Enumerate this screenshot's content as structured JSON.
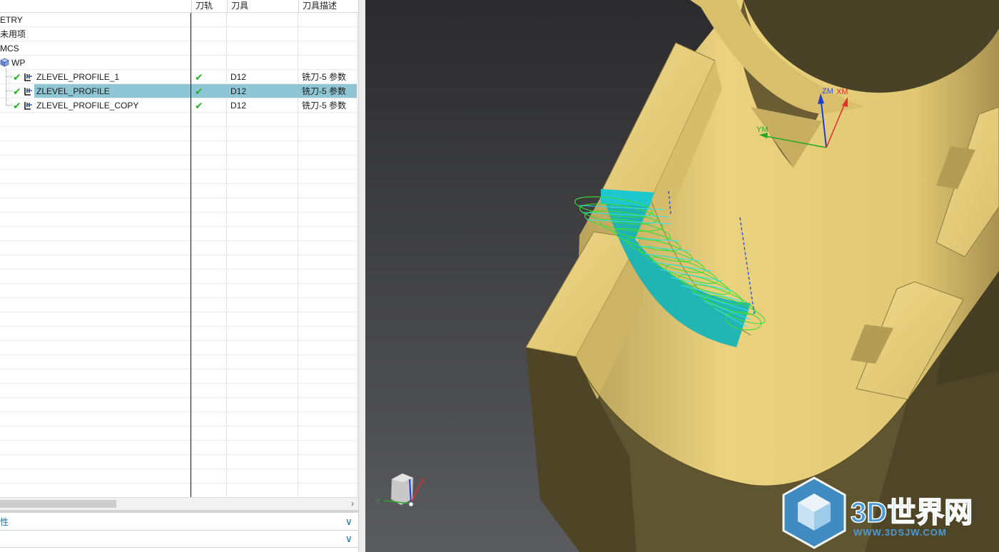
{
  "navigator": {
    "columns": {
      "toolpath": "刀轨",
      "tool": "刀具",
      "tool_desc": "刀具描述"
    },
    "rows": [
      {
        "name": "ETRY",
        "toolpath": "",
        "tool": "",
        "tool_desc": ""
      },
      {
        "name": "未用项",
        "toolpath": "",
        "tool": "",
        "tool_desc": ""
      },
      {
        "name": "MCS",
        "toolpath": "",
        "tool": "",
        "tool_desc": ""
      },
      {
        "name": "WP",
        "toolpath": "",
        "tool": "",
        "tool_desc": ""
      },
      {
        "name": "ZLEVEL_PROFILE_1",
        "toolpath": "✔",
        "tool": "D12",
        "tool_desc": "铣刀-5 参数"
      },
      {
        "name": "ZLEVEL_PROFILE",
        "toolpath": "✔",
        "tool": "D12",
        "tool_desc": "铣刀-5 参数",
        "selected": true
      },
      {
        "name": "ZLEVEL_PROFILE_COPY",
        "toolpath": "✔",
        "tool": "D12",
        "tool_desc": "铣刀-5 参数"
      }
    ],
    "scroll_arrow": "›",
    "sections": [
      {
        "label": "性",
        "chevron": "∨"
      },
      {
        "label": "",
        "chevron": "∨"
      }
    ]
  },
  "viewport": {
    "wcs_labels": {
      "zm": "ZM",
      "xm": "XM",
      "ym": "YM"
    },
    "triad_labels": {
      "x": "X",
      "y": "Y"
    },
    "watermark": {
      "brand": "3D世界网",
      "url": "WWW.3DSJW.COM"
    }
  },
  "colors": {
    "part_face": "#e8cf7c",
    "part_shadow": "#5d5330",
    "toolpath_green": "#3ddc34",
    "toolpath_cyan": "#39e0f0",
    "cut_region": "#10b3b8",
    "selection": "#8fc6d5",
    "accent_blue": "#1f6fa8"
  }
}
